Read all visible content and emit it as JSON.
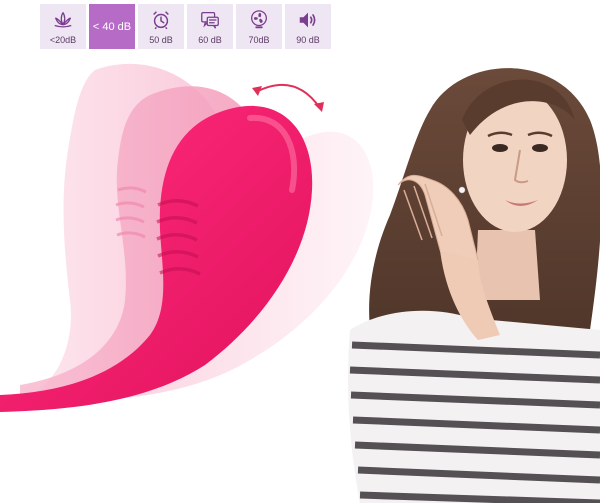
{
  "noise_levels": [
    {
      "label": "<20dB",
      "icon": "lotus-icon",
      "active": false
    },
    {
      "label": "< 40 dB",
      "icon": "",
      "active": true
    },
    {
      "label": "50 dB",
      "icon": "alarm-clock-icon",
      "active": false
    },
    {
      "label": "60 dB",
      "icon": "chat-bubble-icon",
      "active": false
    },
    {
      "label": "70dB",
      "icon": "fan-icon",
      "active": false
    },
    {
      "label": "90 dB",
      "icon": "speaker-icon",
      "active": false
    }
  ],
  "colors": {
    "accent": "#b66cc7",
    "icon": "#7a3d8f",
    "tile": "#efe6f3",
    "product": "#f0186a",
    "product_ghost": "#f7a8c4",
    "arrow": "#e0305a"
  }
}
